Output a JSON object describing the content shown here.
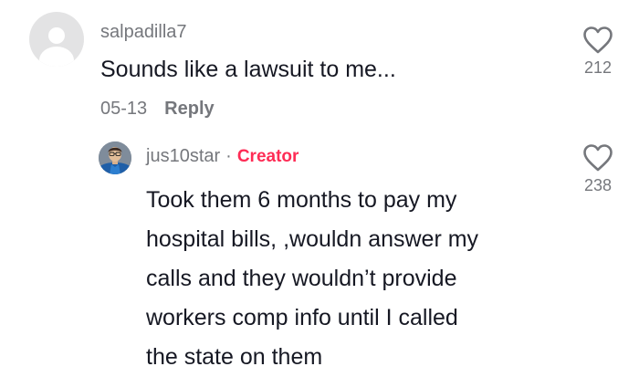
{
  "comment": {
    "username": "salpadilla7",
    "text": "Sounds like a lawsuit to me...",
    "date": "05-13",
    "reply_label": "Reply",
    "like_count": "212",
    "avatar_icon": "default-user-avatar-icon",
    "like_icon": "heart-outline-icon"
  },
  "reply": {
    "username": "jus10star",
    "separator": "·",
    "badge": "Creator",
    "lines": [
      "Took them 6 months to pay my",
      "hospital bills, ,wouldn answer my",
      "calls and they wouldn’t provide",
      "workers comp info until I called",
      "the state on them"
    ],
    "like_count": "238",
    "like_icon": "heart-outline-icon"
  },
  "colors": {
    "primary_text": "#161823",
    "secondary_text": "#75777c",
    "creator_badge": "#fe2c55",
    "avatar_placeholder": "#e3e3e4"
  }
}
